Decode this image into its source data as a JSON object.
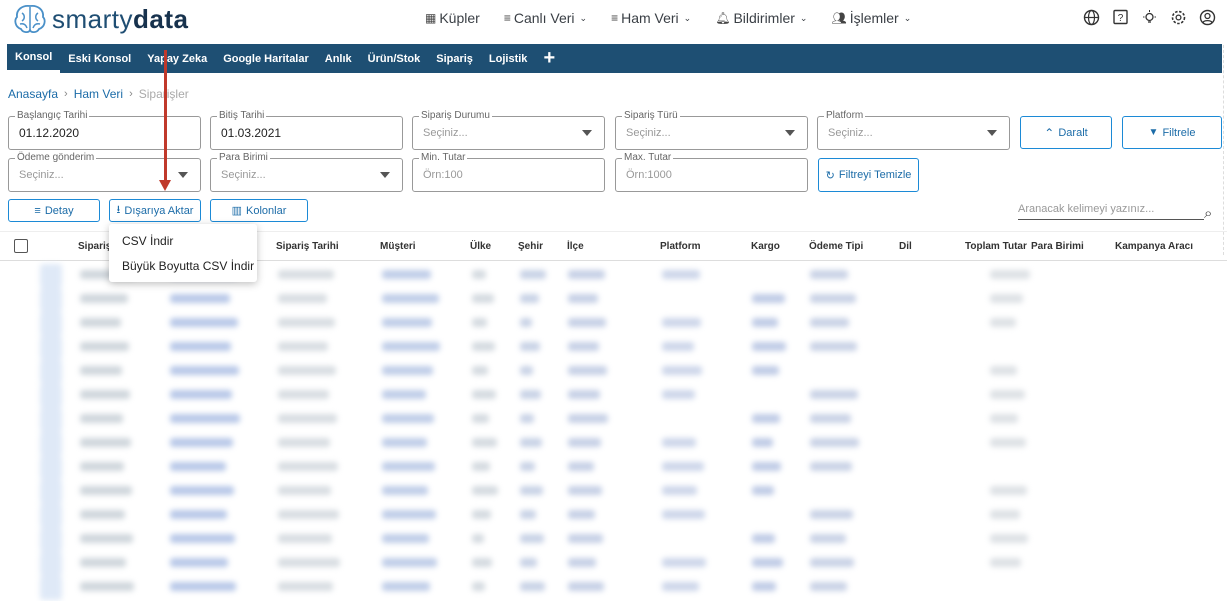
{
  "logo": {
    "text_light": "smarty",
    "text_bold": "data"
  },
  "top_nav": [
    {
      "label": "Küpler",
      "icon": "cubes-icon"
    },
    {
      "label": "Canlı Veri",
      "icon": "list-icon"
    },
    {
      "label": "Ham Veri",
      "icon": "list-icon"
    },
    {
      "label": "Bildirimler",
      "icon": "bell-icon"
    },
    {
      "label": "İşlemler",
      "icon": "users-icon"
    }
  ],
  "top_icons": [
    "globe-icon",
    "help-icon",
    "lightbulb-icon",
    "gear-icon",
    "user-icon"
  ],
  "tabs": [
    "Konsol",
    "Eski Konsol",
    "Yapay Zeka",
    "Google Haritalar",
    "Anlık",
    "Ürün/Stok",
    "Sipariş",
    "Lojistik"
  ],
  "active_tab": "Konsol",
  "breadcrumb": {
    "home": "Anasayfa",
    "section": "Ham Veri",
    "current": "Siparişler"
  },
  "filters": {
    "start_date": {
      "label": "Başlangıç Tarihi",
      "value": "01.12.2020"
    },
    "end_date": {
      "label": "Bitiş Tarihi",
      "value": "01.03.2021"
    },
    "order_status": {
      "label": "Sipariş Durumu",
      "placeholder": "Seçiniz..."
    },
    "order_type": {
      "label": "Sipariş Türü",
      "placeholder": "Seçiniz..."
    },
    "platform": {
      "label": "Platform",
      "placeholder": "Seçiniz..."
    },
    "payment": {
      "label": "Ödeme gönderim",
      "placeholder": "Seçiniz..."
    },
    "currency": {
      "label": "Para Birimi",
      "placeholder": "Seçiniz..."
    },
    "min_amount": {
      "label": "Min. Tutar",
      "placeholder": "Örn:100"
    },
    "max_amount": {
      "label": "Max. Tutar",
      "placeholder": "Örn:1000"
    }
  },
  "buttons": {
    "collapse": "Daralt",
    "filter": "Filtrele",
    "clear_filter": "Filtreyi Temizle",
    "detail": "Detay",
    "export": "Dışarıya Aktar",
    "columns": "Kolonlar"
  },
  "search": {
    "placeholder": "Aranacak kelimeyi yazınız..."
  },
  "columns": [
    "Sipariş",
    "Sipariş Tarihi",
    "Müşteri",
    "Ülke",
    "Şehir",
    "İlçe",
    "Platform",
    "Kargo",
    "Ödeme Tipi",
    "Dil",
    "Toplam Tutar",
    "Para Birimi",
    "Kampanya Aracı"
  ],
  "export_menu": [
    "CSV İndir",
    "Büyük Boyutta CSV İndir"
  ],
  "accent_color": "#1e4f73",
  "annotation_color": "#c0392b"
}
